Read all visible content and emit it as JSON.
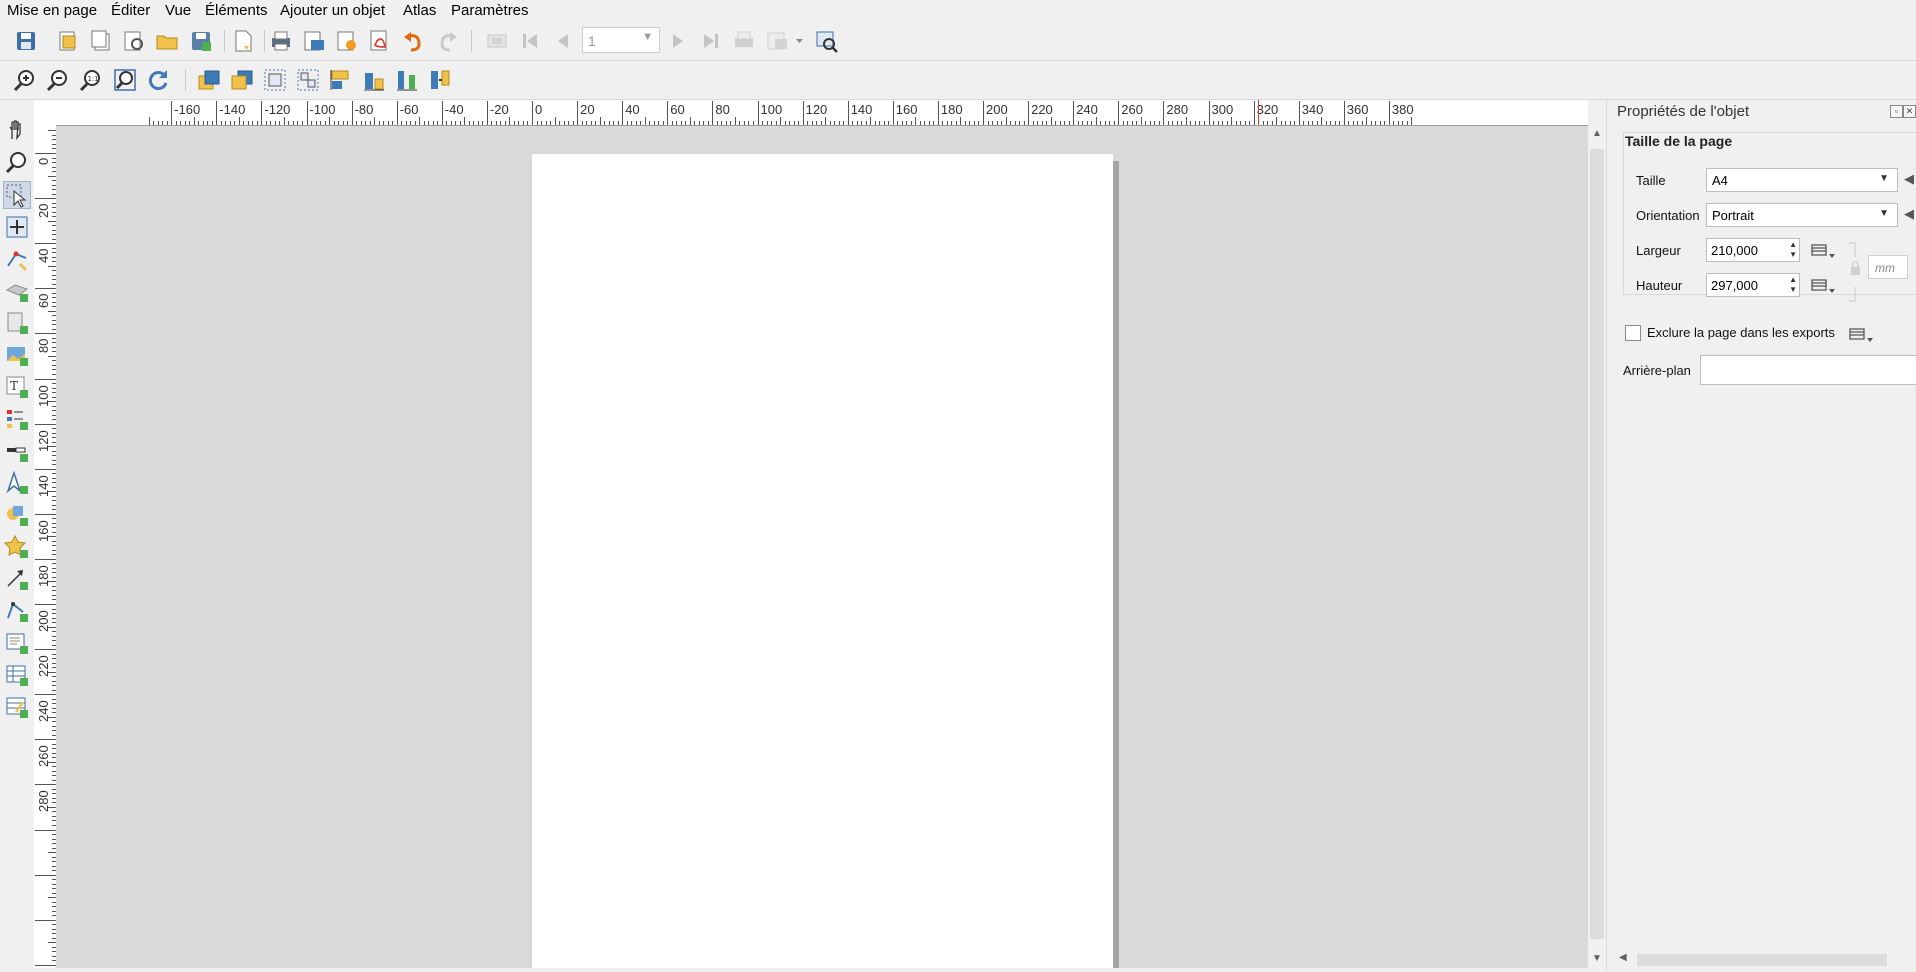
{
  "menu": [
    "Mise en page",
    "Éditer",
    "Vue",
    "Éléments",
    "Ajouter un objet",
    "Atlas",
    "Paramètres"
  ],
  "toolbar1": {
    "page_number": "1",
    "icons": [
      "save-layout-icon",
      "new-layout-icon",
      "duplicate-layout-icon",
      "layout-manager-icon",
      "open-template-icon",
      "save-template-icon",
      "page-properties-icon",
      "print-icon",
      "export-image-icon",
      "export-svg-icon",
      "export-pdf-icon",
      "undo-icon",
      "redo-icon",
      "atlas-preview-icon",
      "first-feature-icon",
      "previous-feature-icon",
      "next-feature-icon",
      "last-feature-icon",
      "print-atlas-icon",
      "export-atlas-icon",
      "atlas-settings-icon"
    ]
  },
  "toolbar2": {
    "icons": [
      "zoom-in-icon",
      "zoom-out-icon",
      "zoom-actual-icon",
      "zoom-full-icon",
      "refresh-icon",
      "raise-items-icon",
      "lower-items-icon",
      "group-icon",
      "ungroup-icon",
      "align-left-icon",
      "align-bottom-icon",
      "distribute-icon",
      "resize-icon"
    ]
  },
  "left_tools": [
    "pan-icon",
    "zoom-tool-icon",
    "select-move-icon",
    "move-content-icon",
    "edit-nodes-icon",
    "add-3d-map-icon",
    "add-map-icon",
    "add-picture-icon",
    "add-label-icon",
    "add-legend-icon",
    "add-scalebar-icon",
    "add-north-arrow-icon",
    "add-shape-icon",
    "add-marker-icon",
    "add-arrow-icon",
    "add-node-item-icon",
    "add-html-icon",
    "add-attribute-table-icon",
    "add-fixed-table-icon"
  ],
  "ruler_h_labels": [
    "-160",
    "-140",
    "-120",
    "-100",
    "-80",
    "-60",
    "-40",
    "-20",
    "0",
    "20",
    "40",
    "60",
    "80",
    "100",
    "120",
    "140",
    "160",
    "180",
    "200",
    "220",
    "240",
    "260",
    "280",
    "300",
    "320",
    "340",
    "360",
    "380"
  ],
  "ruler_v_labels": [
    "0",
    "20",
    "40",
    "60",
    "80",
    "100",
    "120",
    "140",
    "160",
    "180",
    "200",
    "220",
    "240",
    "260",
    "280"
  ],
  "panel": {
    "title": "Propriétés de l'objet",
    "group_title": "Taille de la page",
    "taille_label": "Taille",
    "taille_value": "A4",
    "orientation_label": "Orientation",
    "orientation_value": "Portrait",
    "largeur_label": "Largeur",
    "largeur_value": "210,000",
    "hauteur_label": "Hauteur",
    "hauteur_value": "297,000",
    "unit": "mm",
    "exclude_label": "Exclure la page dans les exports",
    "exclude_checked": false,
    "background_label": "Arrière-plan"
  },
  "colors": {
    "accent_red": "#e0312a",
    "qgis_yellow": "#f0c14b",
    "qgis_blue": "#3d7ab8",
    "qgis_green": "#4caf50"
  }
}
